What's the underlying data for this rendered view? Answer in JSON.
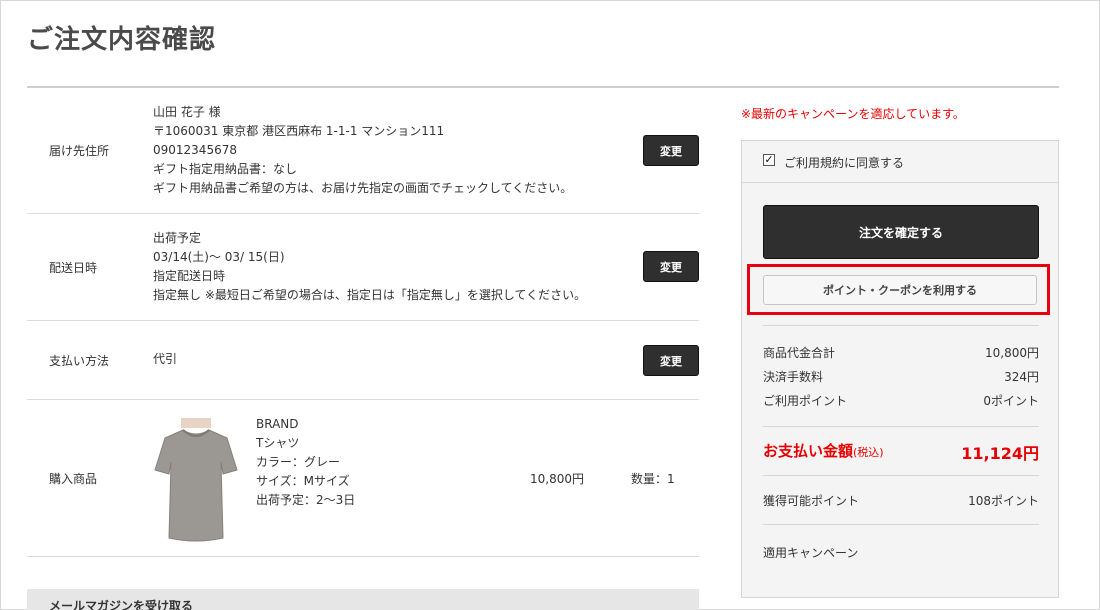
{
  "page": {
    "title": "ご注文内容確認"
  },
  "rows": {
    "address": {
      "label": "届け先住所",
      "lines": [
        "山田 花子 様",
        "〒1060031 東京都 港区西麻布 1-1-1 マンション111",
        "09012345678",
        "ギフト指定用納品書：なし",
        "ギフト用納品書ご希望の方は、お届け先指定の画面でチェックしてください。"
      ]
    },
    "delivery": {
      "label": "配送日時",
      "lines": [
        "出荷予定",
        "03/14(土)～ 03/ 15(日)",
        "指定配送日時",
        "指定無し ※最短日ご希望の場合は、指定日は「指定無し」を選択してください。"
      ]
    },
    "payment": {
      "label": "支払い方法",
      "value": "代引"
    },
    "product": {
      "label": "購入商品",
      "lines": [
        "BRAND",
        "Tシャツ",
        "カラー：グレー",
        "サイズ：Mサイズ",
        "出荷予定：2～3日"
      ],
      "price": "10,800円",
      "quantity": "数量：1"
    },
    "change_label": "変更"
  },
  "mail": {
    "label": "メールマガジンを受け取る"
  },
  "sidebar": {
    "campaign_notice": "※最新のキャンペーンを適応しています。",
    "agree_label": "ご利用規約に同意する",
    "agree_mark": "✓",
    "confirm_label": "注文を確定する",
    "coupon_label": "ポイント・クーポンを利用する",
    "summary": [
      {
        "label": "商品代金合計",
        "value": "10,800円"
      },
      {
        "label": "決済手数料",
        "value": "324円"
      },
      {
        "label": "ご利用ポイント",
        "value": "0ポイント"
      }
    ],
    "total": {
      "label": "お支払い金額",
      "tax": "(税込)",
      "value": "11,124円"
    },
    "earn": {
      "label": "獲得可能ポイント",
      "value": "108ポイント"
    },
    "campaign_label": "適用キャンペーン"
  },
  "colors": {
    "accent_red": "#e60000",
    "button_dark": "#2f2f2f"
  }
}
